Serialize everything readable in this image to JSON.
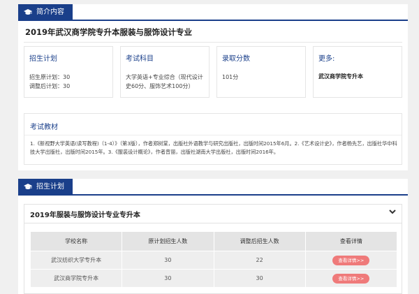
{
  "intro": {
    "tab_label": "简介内容",
    "major_title": "2019年武汉商学院专升本服装与服饰设计专业",
    "cards": [
      {
        "title": "招生计划",
        "lines": [
          "招生原计划：30",
          "调整后计划：30"
        ]
      },
      {
        "title": "考试科目",
        "lines": [
          "大学英语+专业综合（现代设计",
          "史60分、服饰艺术100分）"
        ]
      },
      {
        "title": "录取分数",
        "lines": [
          "101分"
        ]
      },
      {
        "title": "更多:",
        "link": "武汉商学院专升本"
      }
    ],
    "textbook": {
      "title": "考试教材",
      "content": "1.《新视野大学英语(读写教程)（1-4）》（第3版），作者郑树棠，出版社外语教学与研究出版社，出版时间2015年6月。2.《艺术设计史》，作者杨先艺，出版社华中科技大学出版社，出版时间2015年。3.《服装设计概论》，作者曾丽，出版社湖南大学出版社，出版时间2016年。"
    }
  },
  "plan": {
    "tab_label": "招生计划",
    "accordion_title": "2019年服装与服饰设计专业专升本",
    "table": {
      "headers": [
        "学校名称",
        "原计划招生人数",
        "调整后招生人数",
        "查看详情"
      ],
      "rows": [
        {
          "school": "武汉纺织大学专升本",
          "original": "30",
          "adjusted": "22",
          "action": "查看详情>>"
        },
        {
          "school": "武汉商学院专升本",
          "original": "30",
          "adjusted": "30",
          "action": "查看详情>>"
        }
      ]
    }
  },
  "colors": {
    "brand_blue": "#1a3f8a",
    "button_red": "#ef7a7a"
  },
  "icons": {
    "tab": "graduation-cap-icon",
    "accordion": "chevron-down-icon"
  }
}
